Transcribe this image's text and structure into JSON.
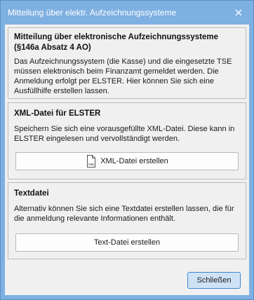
{
  "window": {
    "title": "Mitteilung über elektr. Aufzeichnungssysteme",
    "titlebar_color": "#7fb0e2"
  },
  "info": {
    "heading": "Mitteilung über elektronische Aufzeichnungssysteme (§146a Absatz 4 AO)",
    "body": "Das Aufzeichnungssystem (die Kasse) und die eingesetzte TSE müssen elektronisch beim Finanzamt gemeldet werden. Die Anmeldung erfolgt per ELSTER. Hier können Sie sich eine Ausfüllhilfe erstellen lassen."
  },
  "xml": {
    "heading": "XML-Datei für ELSTER",
    "body": "Speichern Sie sich eine vorausgefüllte XML-Datei. Diese kann in ELSTER eingelesen und vervollständigt werden.",
    "button_label": "XML-Datei erstellen",
    "button_icon": "xml-file-icon"
  },
  "text": {
    "heading": "Textdatei",
    "body": "Alternativ können Sie sich eine Textdatei erstellen lassen, die für die anmeldung relevante Informationen enthält.",
    "button_label": "Text-Datei erstellen"
  },
  "footer": {
    "close_label": "Schließen",
    "accent_color": "#3d86d1"
  }
}
